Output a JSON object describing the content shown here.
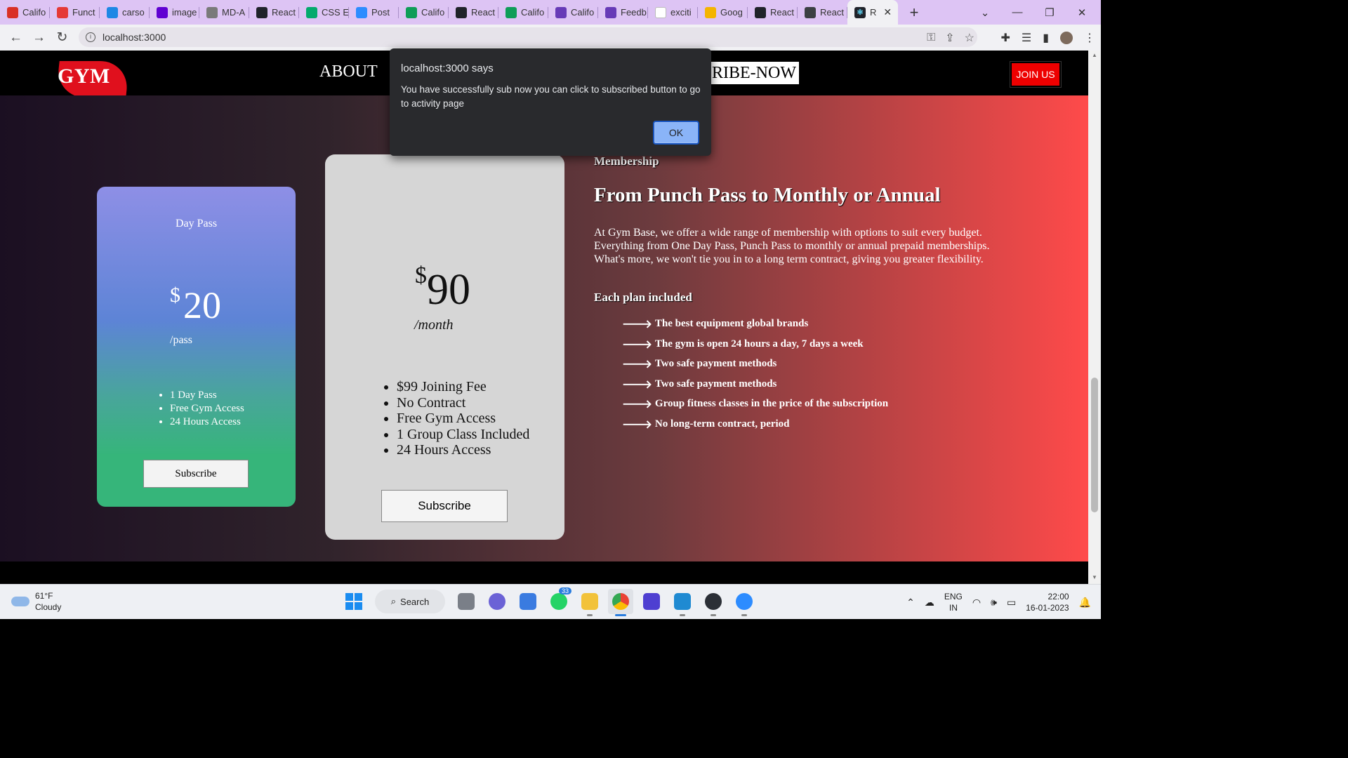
{
  "browser": {
    "tabs": [
      {
        "label": "Califo",
        "icon": "gmail-icon",
        "color": "#d93025"
      },
      {
        "label": "Funct",
        "icon": "firebase-icon",
        "color": "#e53935"
      },
      {
        "label": "carso",
        "icon": "bolt-icon",
        "color": "#1e88e5"
      },
      {
        "label": "image",
        "icon": "yahoo-icon",
        "color": "#6001d2"
      },
      {
        "label": "MD-A",
        "icon": "github-icon",
        "color": "#7a7a7a"
      },
      {
        "label": "React",
        "icon": "react-icon",
        "color": "#20232a"
      },
      {
        "label": "CSS E",
        "icon": "w3-icon",
        "color": "#04aa6d"
      },
      {
        "label": "Post",
        "icon": "zoom-z-icon",
        "color": "#2d8cff"
      },
      {
        "label": "Califo",
        "icon": "sheets-plus-icon",
        "color": "#0f9d58"
      },
      {
        "label": "React",
        "icon": "react-icon",
        "color": "#20232a"
      },
      {
        "label": "Califo",
        "icon": "sheets-plus-icon",
        "color": "#0f9d58"
      },
      {
        "label": "Califo",
        "icon": "forms-icon",
        "color": "#673ab7"
      },
      {
        "label": "Feedb",
        "icon": "forms-icon",
        "color": "#673ab7"
      },
      {
        "label": "exciti",
        "icon": "blank-page-icon",
        "color": "#ffffff"
      },
      {
        "label": "Goog",
        "icon": "meet-icon",
        "color": "#f4b400"
      },
      {
        "label": "React",
        "icon": "react-icon",
        "color": "#20232a"
      },
      {
        "label": "React",
        "icon": "globe-icon",
        "color": "#3c4043"
      }
    ],
    "active_tab": {
      "label": "R",
      "icon": "react-icon",
      "close": "✕"
    },
    "new_tab": "+",
    "url": "localhost:3000"
  },
  "site": {
    "logo": "GYM",
    "nav_about": "ABOUT",
    "nav_subscribe": "RIBE-NOW",
    "join_button": "JOIN US"
  },
  "day_pass": {
    "title": "Day Pass",
    "currency": "$",
    "amount": "20",
    "per": "/pass",
    "features": [
      "1 Day Pass",
      "Free Gym Access",
      "24 Hours Access"
    ],
    "button": "Subscribe"
  },
  "monthly": {
    "currency": "$",
    "amount": "90",
    "per": "/month",
    "features": [
      "$99 Joining Fee",
      "No Contract",
      "Free Gym Access",
      "1 Group Class Included",
      "24 Hours Access"
    ],
    "button": "Subscribe"
  },
  "membership": {
    "eyebrow": "Membership",
    "heading": "From Punch Pass to Monthly or Annual",
    "body": "At Gym Base, we offer a wide range of membership with options to suit every budget. Everything from One Day Pass, Punch Pass to monthly or annual prepaid memberships. What's more, we won't tie you in to a long term contract, giving you greater flexibility.",
    "plan_heading": "Each plan included",
    "arrow": "🡒",
    "plan_items": [
      "The best equipment global brands",
      "The gym is open 24 hours a day, 7 days a week",
      "Two safe payment methods",
      "Two safe payment methods",
      "Group fitness classes in the price of the subscription",
      "No long-term contract, period"
    ]
  },
  "dialog": {
    "title": "localhost:3000 says",
    "message": "You have successfully sub now you can click to subscribed button to go to activity page",
    "ok": "OK"
  },
  "taskbar": {
    "temperature": "61°F",
    "condition": "Cloudy",
    "search": "Search",
    "whatsapp_badge": "33",
    "lang_top": "ENG",
    "lang_bottom": "IN",
    "time": "22:00",
    "date": "16-01-2023"
  },
  "colors": {
    "accent_red": "#ee0000",
    "dialog_bg": "#292a2d",
    "ok_button": "#8ab4f8",
    "tab_strip": "#ddc4f4"
  }
}
